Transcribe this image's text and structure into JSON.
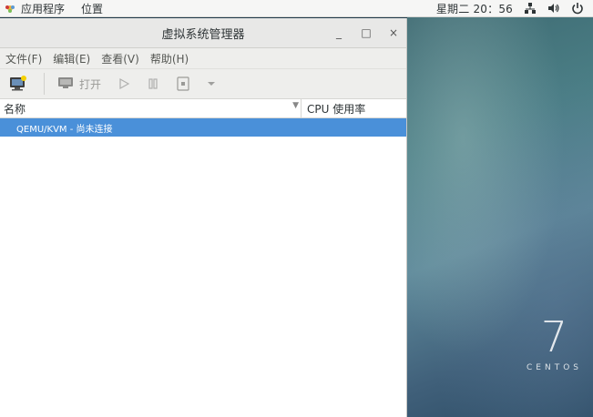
{
  "topbar": {
    "applications": "应用程序",
    "places": "位置",
    "clock": "星期二 20：56",
    "icons": [
      "apps-icon",
      "network-icon",
      "volume-icon",
      "power-icon"
    ]
  },
  "window": {
    "title": "虚拟系统管理器",
    "controls": {
      "minimize": "_",
      "maximize": "□",
      "close": "×"
    },
    "menu": [
      "文件(F)",
      "编辑(E)",
      "查看(V)",
      "帮助(H)"
    ],
    "toolbar": {
      "open_label": "打开",
      "icons": [
        "new-vm-icon",
        "console-icon",
        "play-icon",
        "pause-icon",
        "stop-icon",
        "dropdown-arrow-icon"
      ]
    },
    "columns": {
      "name": "名称",
      "cpu": "CPU 使用率"
    },
    "rows": [
      {
        "label": "QEMU/KVM - 尚未连接",
        "selected": true
      }
    ]
  },
  "desktop": {
    "version": "7",
    "brand": "CENTOS"
  }
}
